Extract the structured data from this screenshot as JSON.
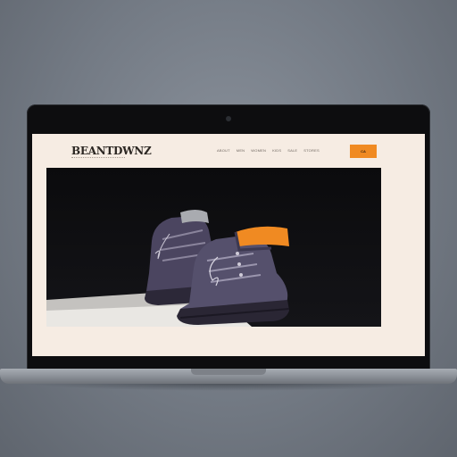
{
  "site": {
    "logo": "BEANTDWNZ",
    "tagline": "",
    "nav": [
      "ABOUT",
      "MEN",
      "WOMEN",
      "KIDS",
      "SALE",
      "STORES"
    ],
    "top_note": "",
    "cta_label": "CA"
  },
  "hero": {
    "image": "boots-product-photo",
    "description_lines": [
      "",
      ""
    ]
  },
  "colors": {
    "page_bg": "#f6ece3",
    "accent": "#f08a22",
    "hero_bg": "#0b0b0d"
  }
}
